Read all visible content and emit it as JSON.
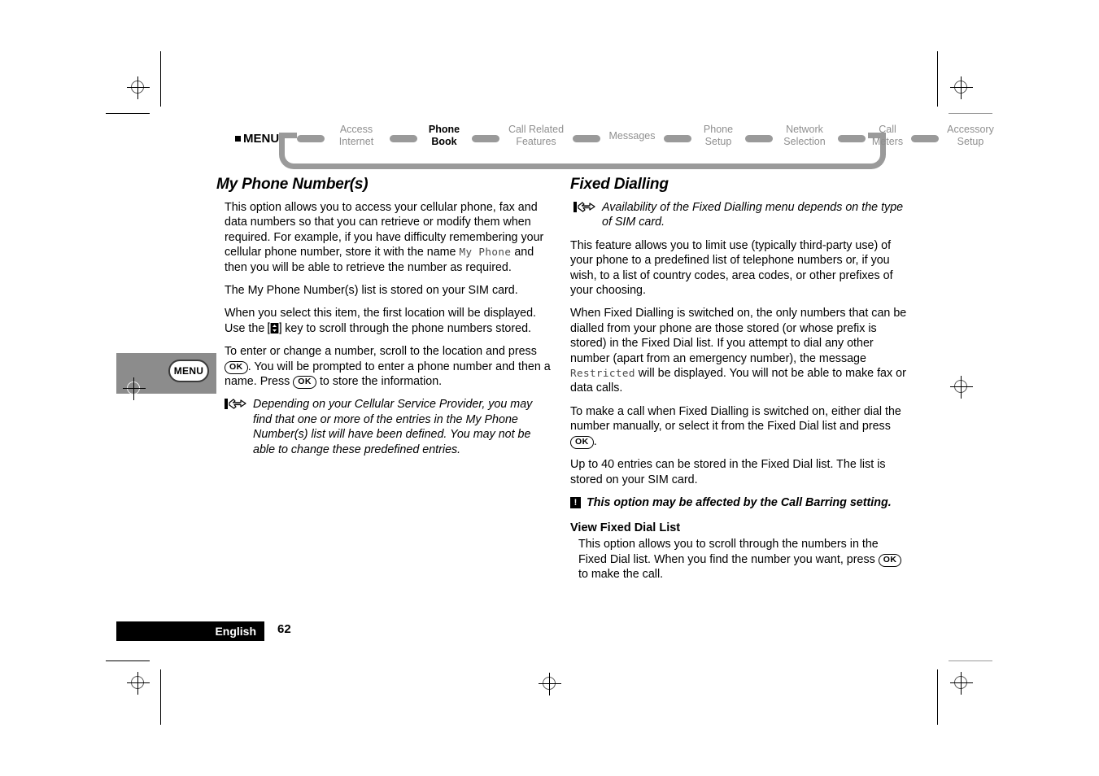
{
  "nav": {
    "menu_label": "MENU",
    "items": [
      {
        "line1": "Access",
        "line2": "Internet",
        "active": false
      },
      {
        "line1": "Phone",
        "line2": "Book",
        "active": true
      },
      {
        "line1": "Call Related",
        "line2": "Features",
        "active": false
      },
      {
        "line1": "Messages",
        "line2": "",
        "active": false
      },
      {
        "line1": "Phone",
        "line2": "Setup",
        "active": false
      },
      {
        "line1": "Network",
        "line2": "Selection",
        "active": false
      },
      {
        "line1": "Call",
        "line2": "Meters",
        "active": false
      },
      {
        "line1": "Accessory",
        "line2": "Setup",
        "active": false
      }
    ]
  },
  "margin_tab": {
    "label": "MENU"
  },
  "left_column": {
    "heading": "My Phone Number(s)",
    "p1_a": "This option allows you to access your cellular phone, fax and data numbers so that you can retrieve or modify them when required. For example, if you have difficulty remembering your cellular phone number, store it with the name ",
    "p1_lcd": "My Phone",
    "p1_b": " and then you will be able to retrieve the number as required.",
    "p2": "The My Phone Number(s) list is stored on your SIM card.",
    "p3_a": "When you select this item, the first location will be displayed. Use the ",
    "p3_b": " key to scroll through the phone numbers stored.",
    "p4_a": "To enter or change a number, scroll to the location and press ",
    "p4_ok1": "OK",
    "p4_b": ". You will be prompted to enter a phone number and then a name. Press ",
    "p4_ok2": "OK",
    "p4_c": " to store the information.",
    "note": "Depending on your Cellular Service Provider, you may find that one or more of the entries in the My Phone Number(s) list will have been defined. You may not be able to change these predefined entries."
  },
  "right_column": {
    "heading": "Fixed Dialling",
    "note1": "Availability of the Fixed Dialling menu depends on the type of SIM card.",
    "p1": "This feature allows you to limit use (typically third-party use) of your phone to a predefined list of telephone numbers or, if you wish, to a list of country codes, area codes, or other prefixes of your choosing.",
    "p2_a": "When Fixed Dialling is switched on, the only numbers that can be dialled from your phone are those stored (or whose prefix is stored) in the Fixed Dial list. If you attempt to dial any other number (apart from an emergency number), the message ",
    "p2_lcd": "Restricted",
    "p2_b": " will be displayed. You will not be able to make fax or data calls.",
    "p3_a": "To make a call when Fixed Dialling is switched on, either dial the number manually, or select it from the Fixed Dial list and press ",
    "p3_ok": "OK",
    "p3_b": ".",
    "p4": "Up to 40 entries can be stored in the Fixed Dial list. The list is stored on your SIM card.",
    "warning": "This option may be affected by the Call Barring setting.",
    "warning_icon_glyph": "!",
    "subheading": "View Fixed Dial List",
    "p5_a": "This option allows you to scroll through the numbers in the Fixed Dial list. When you find the number you want, press ",
    "p5_ok": "OK",
    "p5_b": " to make the call."
  },
  "footer": {
    "language": "English",
    "page_number": "62"
  },
  "colors": {
    "nav_gray": "#9a9a9a",
    "margin_tab_gray": "#8c8c8c",
    "footer_black": "#000000",
    "lcd_text": "#4a4a4a"
  }
}
